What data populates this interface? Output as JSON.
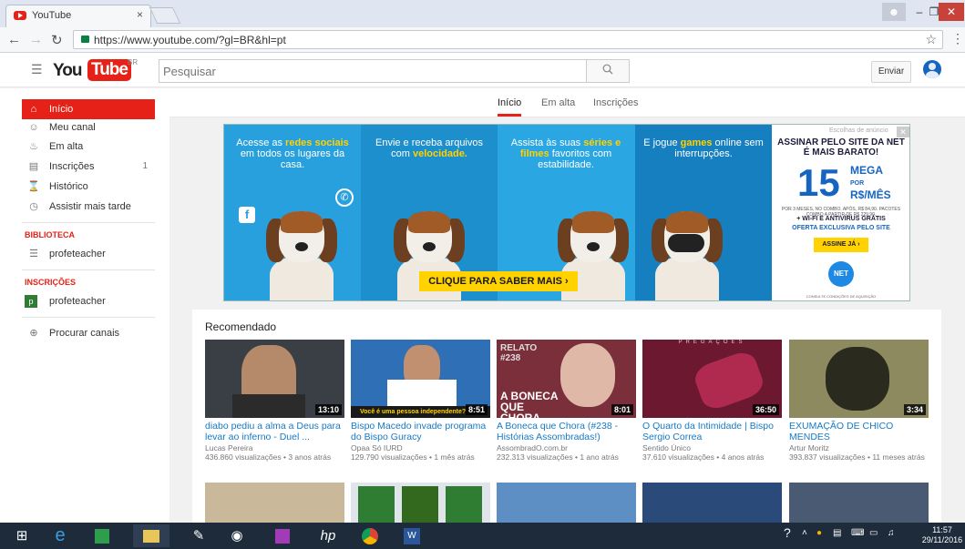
{
  "browser": {
    "tab_title": "YouTube",
    "tab_close": "×",
    "url": "https://www.youtube.com/?gl=BR&hl=pt"
  },
  "masthead": {
    "logo_you": "You",
    "logo_tube": "Tube",
    "logo_region": "BR",
    "search_placeholder": "Pesquisar",
    "upload_label": "Enviar"
  },
  "sidebar": {
    "items": [
      {
        "label": "Início",
        "icon": "home-icon"
      },
      {
        "label": "Meu canal",
        "icon": "person-icon"
      },
      {
        "label": "Em alta",
        "icon": "flame-icon"
      },
      {
        "label": "Inscrições",
        "icon": "subscriptions-icon",
        "count": "1"
      },
      {
        "label": "Histórico",
        "icon": "hourglass-icon"
      },
      {
        "label": "Assistir mais tarde",
        "icon": "clock-icon"
      }
    ],
    "library_header": "BIBLIOTECA",
    "library_items": [
      {
        "label": "profeteacher",
        "icon": "list-icon"
      }
    ],
    "subs_header": "INSCRIÇÕES",
    "subs_items": [
      {
        "label": "profeteacher",
        "badge": "p"
      }
    ],
    "browse_channels": "Procurar canais"
  },
  "main_tabs": [
    {
      "label": "Início",
      "active": true
    },
    {
      "label": "Em alta",
      "active": false
    },
    {
      "label": "Inscrições",
      "active": false
    }
  ],
  "banner": {
    "p1_pre": "Acesse as ",
    "p1_b": "redes sociais",
    "p1_post": " em todos os lugares da casa.",
    "p2_pre": "Envie e receba arquivos com ",
    "p2_b": "velocidade.",
    "p3_pre": "Assista às suas ",
    "p3_b": "séries e filmes",
    "p3_post": " favoritos com estabilidade.",
    "p4_pre": "E jogue ",
    "p4_b": "games",
    "p4_post": " online sem interrupções.",
    "cta": "CLIQUE PARA SABER MAIS ›",
    "p5_headline": "ASSINAR PELO SITE DA NET É MAIS BARATO!",
    "p5_number": "15",
    "p5_mega": "MEGA",
    "p5_por": "POR",
    "p5_rs": "R$/MÊS",
    "p5_fine": "POR 3 MESES, NO COMBO. APÓS, R$ 84,90. PACOTES COMBO A PARTIR DE R$ 229,90.",
    "p5_wifi": "+ WI-FI E ANTIVÍRUS GRÁTIS",
    "p5_offer": "OFERTA EXCLUSIVA PELO SITE",
    "p5_button": "ASSINE JÁ ›",
    "p5_logo": "NET",
    "p5_consult": "CONSULTE CONDIÇÕES DE AQUISIÇÃO",
    "ad_label": "Escolhas de anúncio",
    "ad_close": "✕"
  },
  "recommended": {
    "title": "Recomendado",
    "videos": [
      {
        "title": "diabo pediu a alma a Deus para levar ao inferno - Duel ...",
        "channel": "Lucas Pereira",
        "meta": "436.860 visualizações • 3 anos atrás",
        "duration": "13:10",
        "thumb_color": "#3a3f45"
      },
      {
        "title": "Bispo Macedo invade programa do Bispo Guracy",
        "channel": "Opaa Só IURD",
        "meta": "129.790 visualizações • 1 mês atrás",
        "duration": "8:51",
        "thumb_color": "#2f6fb5",
        "caption": "Você é uma pessoa independente?"
      },
      {
        "title": "A Boneca que Chora (#238 - Histórias Assombradas!)",
        "channel": "AssombradO.com.br",
        "meta": "232.313 visualizações • 1 ano atrás",
        "duration": "8:01",
        "thumb_color": "#7a2f3a",
        "overlay": "A BONECA QUE CHORA",
        "overlay2": "RELATO #238"
      },
      {
        "title": "O Quarto da Intimidade | Bispo Sergio Correa",
        "channel": "Sentido Único",
        "meta": "37.610 visualizações • 4 anos atrás",
        "duration": "36:50",
        "thumb_color": "#6b1830",
        "overlay": "PREGAÇÕES"
      },
      {
        "title": "EXUMAÇÃO DE CHICO MENDES",
        "channel": "Artur Moritz",
        "meta": "393.837 visualizações • 11 meses atrás",
        "duration": "3:34",
        "thumb_color": "#8c8a5e"
      }
    ]
  },
  "taskbar": {
    "time": "11:57",
    "date": "29/11/2016"
  }
}
